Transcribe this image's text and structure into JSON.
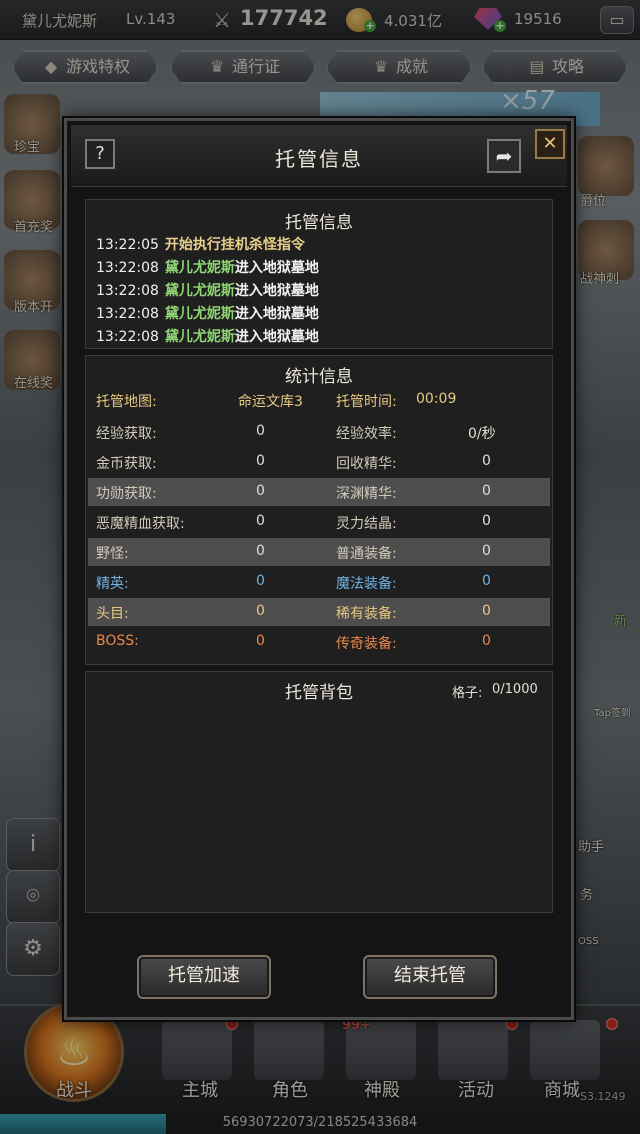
{
  "topbar": {
    "player_name": "黛儿尤妮斯",
    "level": "Lv.143",
    "combat_power": "177742",
    "gold": "4.031亿",
    "diamonds": "19516",
    "icons": {
      "power": "crossed-swords-icon",
      "gold": "gold-coin-icon",
      "diamond": "gem-icon",
      "chat": "chat-icon",
      "add": "plus-icon"
    }
  },
  "nav": [
    {
      "label": "游戏特权",
      "icon": "diamond-icon"
    },
    {
      "label": "通行证",
      "icon": "crown-icon"
    },
    {
      "label": "成就",
      "icon": "crown-icon"
    },
    {
      "label": "攻略",
      "icon": "book-icon"
    }
  ],
  "background": {
    "multiplier": "×57",
    "side_left": [
      "珍宝",
      "首充奖",
      "版本开",
      "在线奖"
    ],
    "side_right": [
      "爵位",
      "战神刺"
    ],
    "right_stubs": [
      "助手",
      "务",
      "OSS",
      "新",
      "Tap签到"
    ],
    "bottom": [
      {
        "label": "战斗",
        "icon": "flame-icon"
      },
      {
        "label": "主城",
        "icon": "castle-icon"
      },
      {
        "label": "角色",
        "icon": "helmet-icon"
      },
      {
        "label": "神殿",
        "icon": "temple-icon"
      },
      {
        "label": "活动",
        "icon": "banner-icon"
      },
      {
        "label": "商城",
        "icon": "diamond-icon"
      }
    ],
    "exp_text": "56930722073/218525433684",
    "exp_fraction": 0.26,
    "badge_99": "99+",
    "corner_code": "S3.1249"
  },
  "modal": {
    "title": "托管信息",
    "help": "?",
    "close": "✕",
    "log_panel": {
      "title": "托管信息",
      "lines": [
        {
          "time": "13:22:05",
          "parts": [
            {
              "text": "开始执行挂机杀怪指令",
              "style": "y"
            }
          ]
        },
        {
          "time": "13:22:08",
          "parts": [
            {
              "text": "黛儿尤妮斯",
              "style": "g"
            },
            {
              "text": "进入地狱墓地",
              "style": "w"
            }
          ]
        },
        {
          "time": "13:22:08",
          "parts": [
            {
              "text": "黛儿尤妮斯",
              "style": "g"
            },
            {
              "text": "进入地狱墓地",
              "style": "w"
            }
          ]
        },
        {
          "time": "13:22:08",
          "parts": [
            {
              "text": "黛儿尤妮斯",
              "style": "g"
            },
            {
              "text": "进入地狱墓地",
              "style": "w"
            }
          ]
        },
        {
          "time": "13:22:08",
          "parts": [
            {
              "text": "黛儿尤妮斯",
              "style": "g"
            },
            {
              "text": "进入地狱墓地",
              "style": "w"
            }
          ]
        }
      ]
    },
    "stats_panel": {
      "title": "统计信息",
      "map_label": "托管地图:",
      "map_value": "命运文库3",
      "time_label": "托管时间:",
      "time_value": "00:09",
      "rows": [
        {
          "l1": "经验获取:",
          "v1": "0",
          "l2": "经验效率:",
          "v2": "0/秒",
          "color": "val",
          "alt": false
        },
        {
          "l1": "金币获取:",
          "v1": "0",
          "l2": "回收精华:",
          "v2": "0",
          "color": "val",
          "alt": false
        },
        {
          "l1": "功勋获取:",
          "v1": "0",
          "l2": "深渊精华:",
          "v2": "0",
          "color": "val",
          "alt": true
        },
        {
          "l1": "恶魔精血获取:",
          "v1": "0",
          "l2": "灵力结晶:",
          "v2": "0",
          "color": "val",
          "alt": false
        },
        {
          "l1": "野怪:",
          "v1": "0",
          "l2": "普通装备:",
          "v2": "0",
          "color": "val",
          "alt": true
        },
        {
          "l1": "精英:",
          "v1": "0",
          "l2": "魔法装备:",
          "v2": "0",
          "color": "blue",
          "alt": false
        },
        {
          "l1": "头目:",
          "v1": "0",
          "l2": "稀有装备:",
          "v2": "0",
          "color": "gold",
          "alt": true
        },
        {
          "l1": "BOSS:",
          "v1": "0",
          "l2": "传奇装备:",
          "v2": "0",
          "color": "orange",
          "alt": false
        }
      ]
    },
    "bag_panel": {
      "title": "托管背包",
      "slots_label": "格子:",
      "slots_value": "0/1000"
    },
    "buttons": {
      "speedup": "托管加速",
      "end": "结束托管"
    }
  }
}
